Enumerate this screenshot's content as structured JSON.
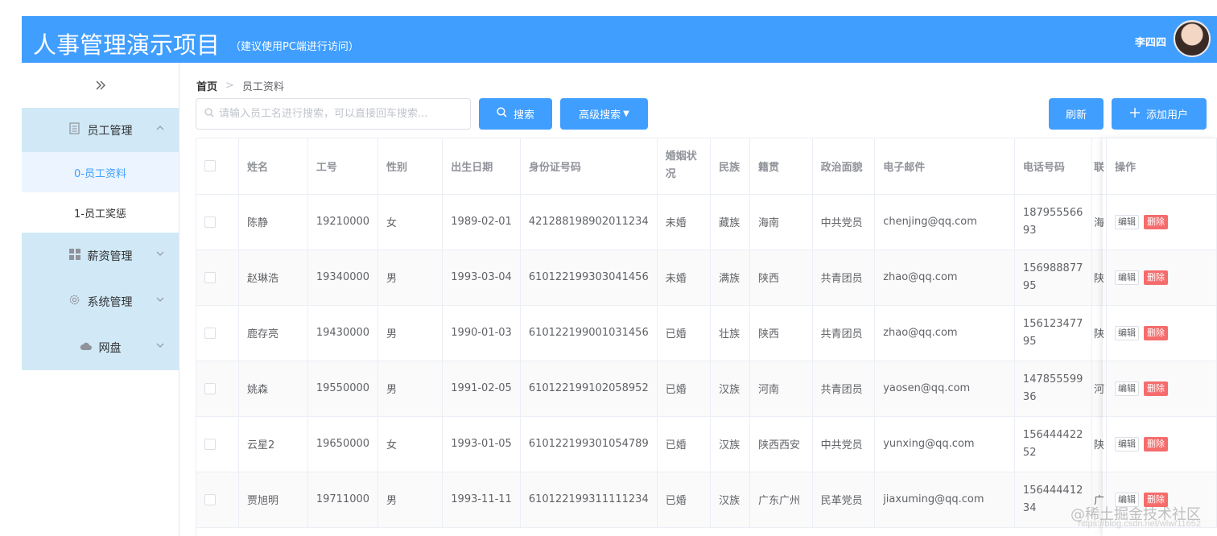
{
  "header": {
    "title": "人事管理演示项目",
    "subtitle": "（建议使用PC端进行访问）",
    "username": "李四四",
    "bg_color": "#409eff"
  },
  "sidebar": {
    "collapse_icon": "double-chevron-right-icon",
    "groups": [
      {
        "label": "员工管理",
        "icon": "document-icon",
        "expanded": true,
        "items": [
          {
            "label": "0-员工资料",
            "active": true
          },
          {
            "label": "1-员工奖惩",
            "active": false
          }
        ]
      },
      {
        "label": "薪资管理",
        "icon": "grid-icon",
        "expanded": false
      },
      {
        "label": "系统管理",
        "icon": "gear-icon",
        "expanded": false
      },
      {
        "label": "网盘",
        "icon": "cloud-icon",
        "expanded": false
      }
    ]
  },
  "breadcrumb": {
    "home": "首页",
    "separator": ">",
    "current": "员工资料"
  },
  "toolbar": {
    "search_placeholder": "请输入员工名进行搜索，可以直接回车搜索...",
    "search_value": "",
    "search_label": "搜索",
    "advanced_label": "高级搜索",
    "refresh_label": "刷新",
    "add_label": "添加用户"
  },
  "table": {
    "columns": [
      "姓名",
      "工号",
      "性别",
      "出生日期",
      "身份证号码",
      "婚姻状况",
      "民族",
      "籍贯",
      "政治面貌",
      "电子邮件",
      "电话号码",
      "联",
      "操作"
    ],
    "edit_label": "编辑",
    "delete_label": "删除",
    "rows": [
      {
        "name": "陈静",
        "id": "19210000",
        "gender": "女",
        "birth": "1989-02-01",
        "idcard": "421288198902011234",
        "marital": "未婚",
        "nation": "藏族",
        "native": "海南",
        "politics": "中共党员",
        "email": "chenjing@qq.com",
        "phone": "18795556693",
        "extra": "海"
      },
      {
        "name": "赵琳浩",
        "id": "19340000",
        "gender": "男",
        "birth": "1993-03-04",
        "idcard": "610122199303041456",
        "marital": "未婚",
        "nation": "满族",
        "native": "陕西",
        "politics": "共青团员",
        "email": "zhao@qq.com",
        "phone": "15698887795",
        "extra": "陕"
      },
      {
        "name": "鹿存亮",
        "id": "19430000",
        "gender": "男",
        "birth": "1990-01-03",
        "idcard": "610122199001031456",
        "marital": "已婚",
        "nation": "壮族",
        "native": "陕西",
        "politics": "共青团员",
        "email": "zhao@qq.com",
        "phone": "15612347795",
        "extra": "陕"
      },
      {
        "name": "姚森",
        "id": "19550000",
        "gender": "男",
        "birth": "1991-02-05",
        "idcard": "610122199102058952",
        "marital": "已婚",
        "nation": "汉族",
        "native": "河南",
        "politics": "共青团员",
        "email": "yaosen@qq.com",
        "phone": "14785559936",
        "extra": "河"
      },
      {
        "name": "云星2",
        "id": "19650000",
        "gender": "女",
        "birth": "1993-01-05",
        "idcard": "610122199301054789",
        "marital": "已婚",
        "nation": "汉族",
        "native": "陕西西安",
        "politics": "中共党员",
        "email": "yunxing@qq.com",
        "phone": "15644442252",
        "extra": "陕"
      },
      {
        "name": "贾旭明",
        "id": "19711000",
        "gender": "男",
        "birth": "1993-11-11",
        "idcard": "610122199311111234",
        "marital": "已婚",
        "nation": "汉族",
        "native": "广东广州",
        "politics": "民革党员",
        "email": "jiaxuming@qq.com",
        "phone": "15644441234",
        "extra": "广"
      }
    ]
  },
  "watermark": {
    "line1": "@稀土掘金技术社区",
    "line2": "https://blog.csdn.net/wlw/11652"
  }
}
